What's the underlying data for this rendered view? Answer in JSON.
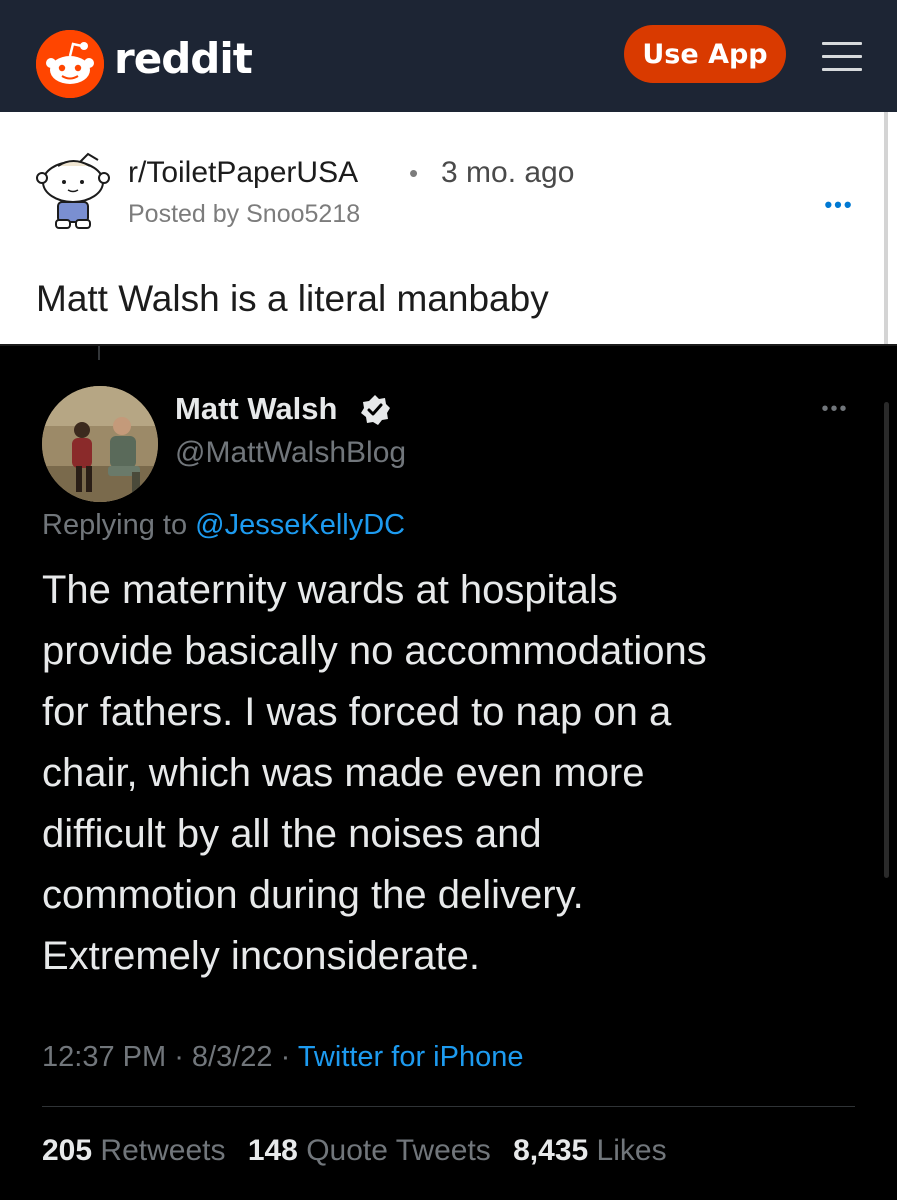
{
  "header": {
    "logo_text": "reddit",
    "use_app_label": "Use App"
  },
  "post": {
    "subreddit": "r/ToiletPaperUSA",
    "separator": "•",
    "time_ago": "3 mo. ago",
    "posted_by": "Posted by Snoo5218",
    "more": "•••",
    "title": "Matt Walsh is a literal manbaby"
  },
  "tweet": {
    "name": "Matt Walsh",
    "handle": "@MattWalshBlog",
    "more": "•••",
    "replying_prefix": "Replying to ",
    "replying_mention": "@JesseKellyDC",
    "body_lines": [
      "The maternity wards at hospitals",
      "provide basically no accommodations",
      "for fathers. I was forced to nap on a",
      "chair, which was made even more",
      "difficult by all the noises and",
      "commotion during the delivery.",
      "Extremely inconsiderate."
    ],
    "time": "12:37 PM",
    "meta_sep": " · ",
    "date": "8/3/22",
    "source": "Twitter for iPhone",
    "stats": {
      "retweets_count": "205",
      "retweets_label": "Retweets",
      "quotes_count": "148",
      "quotes_label": "Quote Tweets",
      "likes_count": "8,435",
      "likes_label": "Likes"
    }
  },
  "colors": {
    "header_bg": "#1d2534",
    "reddit_orange": "#ff4500",
    "use_app_bg": "#d93a00",
    "twitter_blue": "#1d9bf0",
    "tweet_bg": "#000000"
  },
  "icons": [
    "reddit-snoo-icon",
    "hamburger-menu-icon",
    "snoo-avatar-icon",
    "verified-badge-icon",
    "more-options-icon"
  ]
}
